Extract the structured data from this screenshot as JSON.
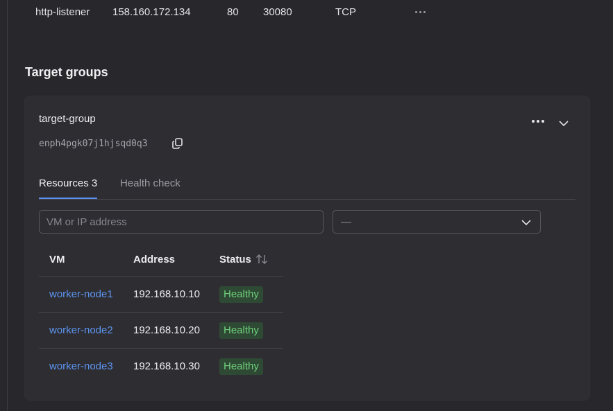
{
  "listener": {
    "name": "http-listener",
    "ip": "158.160.172.134",
    "port": "80",
    "target_port": "30080",
    "protocol": "TCP"
  },
  "section_title": "Target groups",
  "target_group": {
    "name": "target-group",
    "id": "enph4pgk07j1hjsqd0q3"
  },
  "tabs": [
    {
      "label": "Resources 3",
      "active": true
    },
    {
      "label": "Health check",
      "active": false
    }
  ],
  "filters": {
    "search_placeholder": "VM or IP address",
    "search_value": "",
    "select_value": "—"
  },
  "table": {
    "columns": [
      "VM",
      "Address",
      "Status"
    ],
    "rows": [
      {
        "vm": "worker-node1",
        "address": "192.168.10.10",
        "status": "Healthy"
      },
      {
        "vm": "worker-node2",
        "address": "192.168.10.20",
        "status": "Healthy"
      },
      {
        "vm": "worker-node3",
        "address": "192.168.10.30",
        "status": "Healthy"
      }
    ]
  },
  "colors": {
    "background": "#28282c",
    "card": "#2d2d32",
    "link": "#5e95f0",
    "tab_accent": "#5b8ff0",
    "healthy_bg": "#2f4a34",
    "healthy_text": "#6fcf7c"
  },
  "icons": {
    "listener_menu": "ellipsis-icon",
    "copy": "copy-icon",
    "group_menu": "ellipsis-icon",
    "collapse": "chevron-down-icon",
    "select": "chevron-down-icon",
    "sort": "sort-arrows-icon"
  }
}
